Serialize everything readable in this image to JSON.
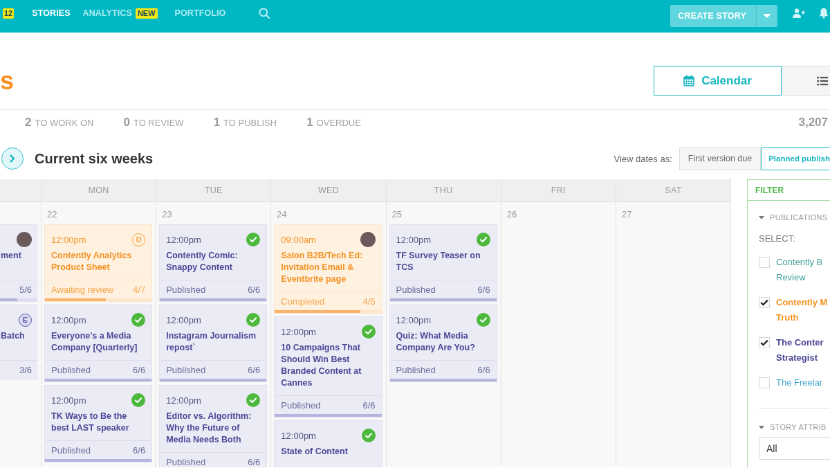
{
  "top_nav": {
    "count_badge": "12",
    "items": [
      {
        "label": "STORIES",
        "selected": true
      },
      {
        "label": "ANALYTICS",
        "selected": false,
        "badge": "NEW"
      },
      {
        "label": "PORTFOLIO",
        "selected": false
      }
    ],
    "create_button": "CREATE STORY"
  },
  "header": {
    "title": "s",
    "views": [
      {
        "kind": "calendar",
        "label": "Calendar",
        "selected": true
      },
      {
        "kind": "list",
        "selected": false
      }
    ]
  },
  "stats": {
    "items": [
      {
        "count": "2",
        "label": "TO WORK ON"
      },
      {
        "count": "0",
        "label": "TO REVIEW"
      },
      {
        "count": "1",
        "label": "TO PUBLISH"
      },
      {
        "count": "1",
        "label": "OVERDUE"
      }
    ],
    "total": "3,207"
  },
  "section": {
    "title": "Current six weeks",
    "date_label": "View dates as:",
    "date_modes": [
      {
        "label": "First version due",
        "selected": false
      },
      {
        "label": "Planned publish",
        "selected": true
      }
    ]
  },
  "calendar": {
    "days": [
      {
        "cards": [
          {
            "kind": "normal",
            "marker": {
              "kind": "avatar"
            },
            "title": "ment",
            "count": "5/6",
            "level": 0.47
          },
          {
            "kind": "normal",
            "marker": {
              "kind": "letter",
              "text": "E"
            },
            "title": "Batch",
            "count": "3/6"
          }
        ]
      },
      {
        "name": "MON",
        "date": "22",
        "cards": [
          {
            "kind": "pending",
            "time": "12:00pm",
            "marker": {
              "kind": "letter",
              "text": "D"
            },
            "title": "Contently Analytics Product Sheet",
            "status": "Awaiting review",
            "count": "4/7",
            "level": 0.57
          },
          {
            "kind": "normal",
            "time": "12:00pm",
            "marker": {
              "kind": "check"
            },
            "title": "Everyone's a Media Company [Quarterly]",
            "status": "Published",
            "count": "6/6",
            "level": 1
          },
          {
            "kind": "normal",
            "time": "12:00pm",
            "marker": {
              "kind": "check"
            },
            "title": "TK Ways to Be the best LAST speaker",
            "status": "Published",
            "count": "6/6",
            "level": 1
          }
        ]
      },
      {
        "name": "TUE",
        "date": "23",
        "cards": [
          {
            "kind": "normal",
            "time": "12:00pm",
            "marker": {
              "kind": "check"
            },
            "title": "Contently Comic: Snappy Content",
            "status": "Published",
            "count": "6/6",
            "level": 1
          },
          {
            "kind": "normal",
            "time": "12:00pm",
            "marker": {
              "kind": "check"
            },
            "title": "Instagram Journalism repost`",
            "status": "Published",
            "count": "6/6",
            "level": 1
          },
          {
            "kind": "normal",
            "time": "12:00pm",
            "marker": {
              "kind": "check"
            },
            "title": "Editor vs. Algorithm: Why the Future of Media Needs Both",
            "status": "Published",
            "count": "6/6"
          }
        ]
      },
      {
        "name": "WED",
        "date": "24",
        "cards": [
          {
            "kind": "pending",
            "time": "09:00am",
            "marker": {
              "kind": "avatar"
            },
            "title": "Salon B2B/Tech Ed: Invitation Email & Eventbrite page",
            "status": "Completed",
            "count": "4/5",
            "level": 0.8
          },
          {
            "kind": "normal",
            "time": "12:00pm",
            "marker": {
              "kind": "check"
            },
            "title": "10 Campaigns That Should Win Best Branded Content at Cannes",
            "status": "Published",
            "count": "6/6",
            "level": 1
          },
          {
            "kind": "normal",
            "time": "12:00pm",
            "marker": {
              "kind": "check"
            },
            "title": "State of Content"
          }
        ]
      },
      {
        "name": "THU",
        "date": "25",
        "cards": [
          {
            "kind": "normal",
            "time": "12:00pm",
            "marker": {
              "kind": "check"
            },
            "title": "TF Survey Teaser on TCS",
            "status": "Published",
            "count": "6/6",
            "level": 1
          },
          {
            "kind": "normal",
            "time": "12:00pm",
            "marker": {
              "kind": "check"
            },
            "title": "Quiz: What Media Company Are You?",
            "status": "Published",
            "count": "6/6",
            "level": 1
          }
        ]
      },
      {
        "name": "FRI",
        "date": "26"
      },
      {
        "name": "SAT",
        "date": "27"
      }
    ]
  },
  "filter": {
    "title": "FILTER",
    "sections": [
      {
        "kind": "publications",
        "title": "PUBLICATIONS",
        "expanded": true,
        "select_label": "SELECT:",
        "items": [
          {
            "label": "Contently B Review",
            "checked": false,
            "color": "#3e9e9a"
          },
          {
            "label": "Contently M Truth",
            "checked": true,
            "color": "#f39325"
          },
          {
            "label": "The Conter Strategist",
            "checked": true,
            "color": "#4b4796"
          },
          {
            "label": "The Freelar",
            "checked": false,
            "color": "#38a3c9"
          }
        ]
      },
      {
        "kind": "attributes",
        "title": "STORY ATTRIB",
        "expanded": true,
        "value": "All"
      }
    ]
  }
}
